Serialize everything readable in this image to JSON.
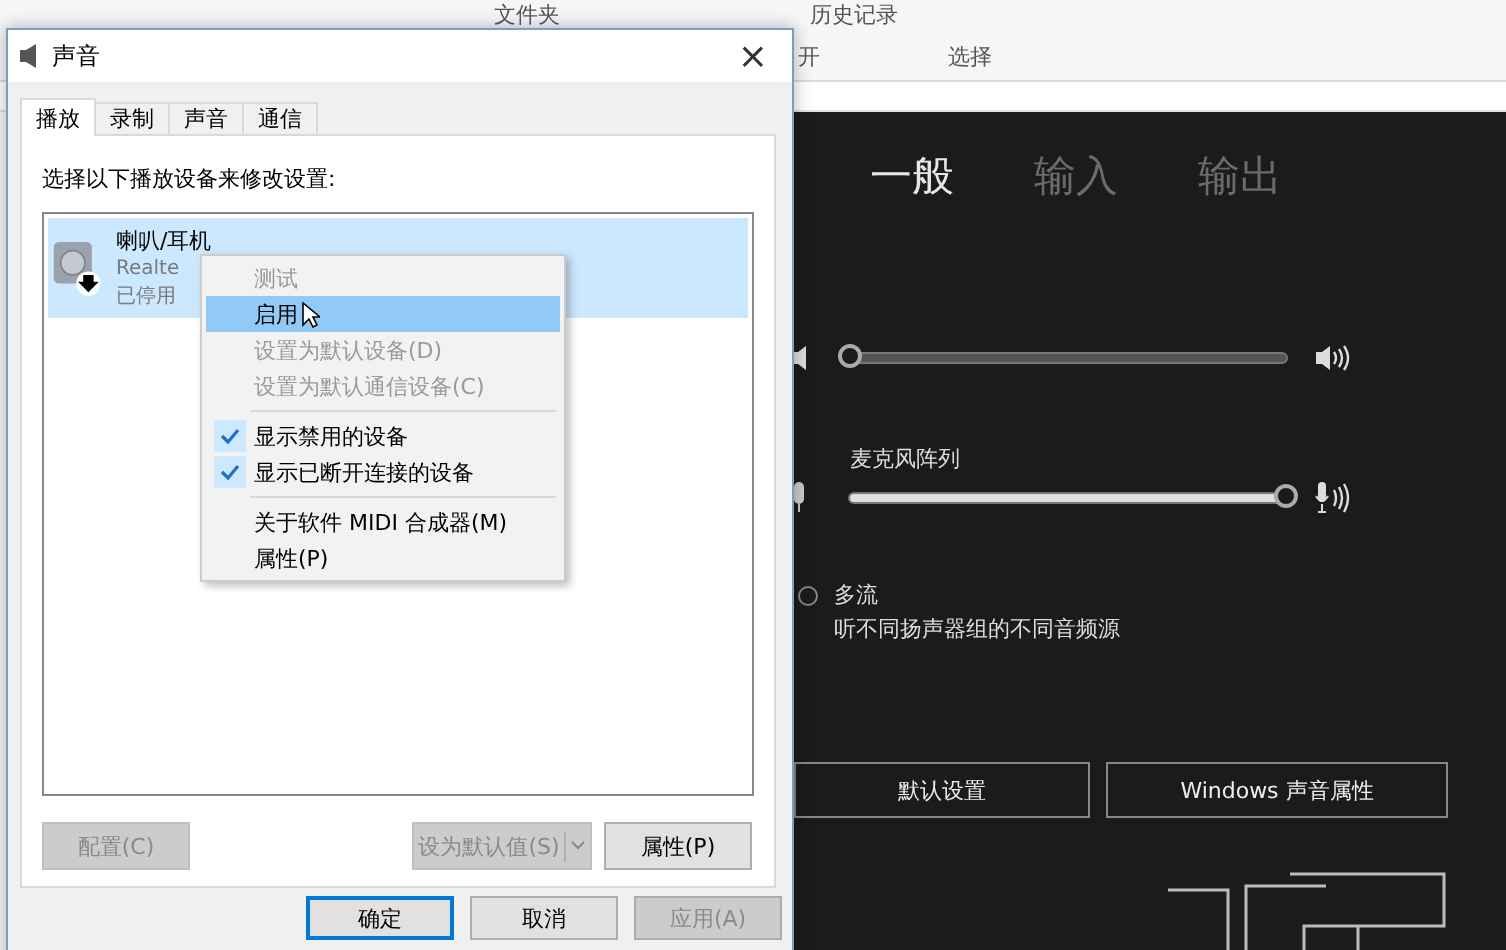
{
  "explorer_ribbon": {
    "labels": [
      "文件夹",
      "历史记录",
      "开",
      "选择"
    ]
  },
  "settings_panel": {
    "tabs": [
      {
        "label": "一般",
        "selected": true
      },
      {
        "label": "输入",
        "selected": false
      },
      {
        "label": "输出",
        "selected": false
      }
    ],
    "sliders": [
      {
        "kind": "speaker",
        "level": 0
      },
      {
        "kind": "microphone",
        "label": "麦克风阵列",
        "level": 1
      }
    ],
    "radio": {
      "label": "多流",
      "description": "听不同扬声器组的不同音频源",
      "selected": false
    },
    "buttons": [
      "默认设置",
      "Windows 声音属性"
    ]
  },
  "dialog": {
    "title": "声音",
    "close": "×",
    "tabs": [
      {
        "label": "播放",
        "selected": true
      },
      {
        "label": "录制",
        "selected": false
      },
      {
        "label": "声音",
        "selected": false
      },
      {
        "label": "通信",
        "selected": false
      }
    ],
    "instruction": "选择以下播放设备来修改设置:",
    "devices": [
      {
        "name": "喇叭/耳机",
        "driver": "Realte",
        "status": "已停用",
        "selected": true,
        "disabled": true
      }
    ],
    "device_buttons": [
      {
        "label": "配置(C)",
        "kind": "plain",
        "disabled": true
      },
      {
        "label": "设为默认值(S)",
        "kind": "split",
        "disabled": true
      },
      {
        "label": "属性(P)",
        "kind": "plain",
        "disabled": false
      }
    ],
    "footer_buttons": [
      {
        "label": "确定",
        "disabled": false
      },
      {
        "label": "取消",
        "disabled": false
      },
      {
        "label": "应用(A)",
        "disabled": true
      }
    ]
  },
  "context_menu": {
    "items": [
      {
        "kind": "item",
        "label": "测试",
        "disabled": true,
        "selected": false,
        "checked": false
      },
      {
        "kind": "item",
        "label": "启用",
        "disabled": false,
        "selected": true,
        "checked": false
      },
      {
        "kind": "item",
        "label": "设置为默认设备(D)",
        "disabled": true,
        "selected": false,
        "checked": false
      },
      {
        "kind": "item",
        "label": "设置为默认通信设备(C)",
        "disabled": true,
        "selected": false,
        "checked": false
      },
      {
        "kind": "separator"
      },
      {
        "kind": "item",
        "label": "显示禁用的设备",
        "disabled": false,
        "selected": false,
        "checked": true
      },
      {
        "kind": "item",
        "label": "显示已断开连接的设备",
        "disabled": false,
        "selected": false,
        "checked": true
      },
      {
        "kind": "separator"
      },
      {
        "kind": "item",
        "label": "关于软件 MIDI 合成器(M)",
        "disabled": false,
        "selected": false,
        "checked": false
      },
      {
        "kind": "item",
        "label": "属性(P)",
        "disabled": false,
        "selected": false,
        "checked": false
      }
    ]
  }
}
